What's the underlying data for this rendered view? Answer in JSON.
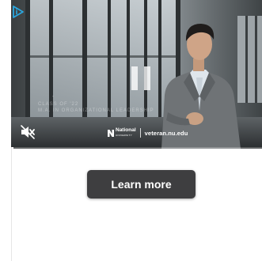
{
  "ad": {
    "caption_line1": "Class of '22",
    "caption_line2": "M.A. in Organizational Leadership",
    "caption_small": "\"",
    "progress_fraction": 0.01,
    "playback": "paused",
    "audio": "muted"
  },
  "brand": {
    "name": "National",
    "sub": "UNIVERSITY",
    "url": "veteran.nu.edu"
  },
  "cta": {
    "label": "Learn more"
  },
  "icons": {
    "adchoices": "adchoices-icon",
    "mute": "speaker-muted-icon",
    "pause": "pause-icon",
    "logo": "national-university-logo-icon"
  },
  "colors": {
    "button_bg": "#3e3e40",
    "button_text": "#ffffff",
    "adchoices": "#2aa6de",
    "video_tone": "#4a4f52"
  }
}
